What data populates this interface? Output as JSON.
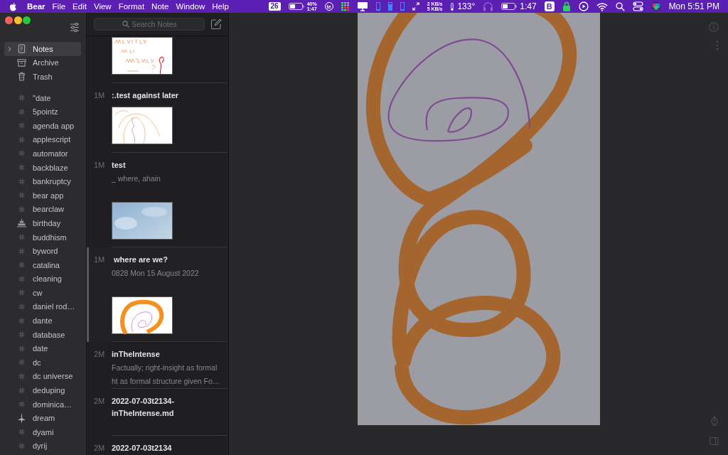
{
  "menu_bar": {
    "menus": [
      {
        "label": "Bear",
        "kind": "app"
      },
      {
        "label": "File",
        "kind": "menu"
      },
      {
        "label": "Edit",
        "kind": "menu"
      },
      {
        "label": "View",
        "kind": "menu"
      },
      {
        "label": "Format",
        "kind": "menu"
      },
      {
        "label": "Note",
        "kind": "menu"
      },
      {
        "label": "Window",
        "kind": "menu"
      },
      {
        "label": "Help",
        "kind": "menu"
      }
    ],
    "status_items": [
      {
        "kind": "badge",
        "text": "26"
      },
      {
        "kind": "battery",
        "lines": [
          "40%",
          "1:47"
        ]
      },
      {
        "kind": "logo",
        "text": "te"
      },
      {
        "kind": "bars"
      },
      {
        "kind": "display"
      },
      {
        "kind": "meter",
        "level": 0.15
      },
      {
        "kind": "meter",
        "level": 0.8
      },
      {
        "kind": "meter",
        "level": 0.1
      },
      {
        "kind": "arrows"
      },
      {
        "kind": "network",
        "lines": [
          "2 KB/s",
          "5 KB/s"
        ]
      },
      {
        "kind": "temperature",
        "text": "133°"
      },
      {
        "kind": "headphones",
        "dimmed": true
      },
      {
        "kind": "battery",
        "lines": [
          "1:47"
        ]
      },
      {
        "kind": "logo_square",
        "text": "B"
      },
      {
        "kind": "lock"
      },
      {
        "kind": "play"
      },
      {
        "kind": "wifi"
      },
      {
        "kind": "search"
      },
      {
        "kind": "toggles"
      },
      {
        "kind": "orb"
      }
    ],
    "clock": "Mon 5:51 PM"
  },
  "sidebar": {
    "sections": [
      {
        "label": "Notes",
        "kind": "notes",
        "selected": true,
        "expanded": false
      },
      {
        "label": "Archive",
        "kind": "archive",
        "selected": false
      },
      {
        "label": "Trash",
        "kind": "trash",
        "selected": false
      }
    ],
    "tags": [
      {
        "label": "\"date",
        "kind": "hash",
        "selected": false
      },
      {
        "label": "5pointz",
        "kind": "hash",
        "selected": false
      },
      {
        "label": "agenda app",
        "kind": "hash",
        "selected": false
      },
      {
        "label": "applescript",
        "kind": "hash",
        "selected": false
      },
      {
        "label": "automator",
        "kind": "hash",
        "selected": false
      },
      {
        "label": "backblaze",
        "kind": "hash",
        "selected": false
      },
      {
        "label": "bankruptcy",
        "kind": "hash",
        "selected": false
      },
      {
        "label": "bear app",
        "kind": "hash",
        "selected": false
      },
      {
        "label": "bearclaw",
        "kind": "hash",
        "selected": false
      },
      {
        "label": "birthday",
        "kind": "cake",
        "selected": false
      },
      {
        "label": "buddhism",
        "kind": "hash",
        "selected": false
      },
      {
        "label": "byword",
        "kind": "hash",
        "selected": false
      },
      {
        "label": "catalina",
        "kind": "hash",
        "selected": false
      },
      {
        "label": "cleaning",
        "kind": "hash",
        "selected": false
      },
      {
        "label": "cw",
        "kind": "hash",
        "selected": false
      },
      {
        "label": "daniel rod…",
        "kind": "hash",
        "selected": false
      },
      {
        "label": "dante",
        "kind": "hash",
        "selected": false
      },
      {
        "label": "database",
        "kind": "hash",
        "selected": false
      },
      {
        "label": "date",
        "kind": "hash",
        "selected": false
      },
      {
        "label": "dc",
        "kind": "hash",
        "selected": false
      },
      {
        "label": "dc universe",
        "kind": "hash",
        "selected": false
      },
      {
        "label": "deduping",
        "kind": "hash",
        "selected": false
      },
      {
        "label": "dominica…",
        "kind": "hash",
        "selected": false
      },
      {
        "label": "dream",
        "kind": "spire",
        "selected": false
      },
      {
        "label": "dyami",
        "kind": "hash",
        "selected": false
      },
      {
        "label": "dyrij",
        "kind": "hash",
        "selected": false
      }
    ]
  },
  "note_list": {
    "search": {
      "placeholder": "Search Notes"
    },
    "notes": [
      {
        "thumbnail": {
          "kind": "handwriting"
        },
        "selected": false
      },
      {
        "age": "1M",
        "title": ":.test against later",
        "thumbnail": {
          "kind": "scribble"
        },
        "selected": false
      },
      {
        "age": "1M",
        "title": "test",
        "preview": [
          "_ where, ahain"
        ],
        "thumbnail": {
          "kind": "photo"
        },
        "selected": false
      },
      {
        "age": "1M",
        "title": " where are we?",
        "preview": [
          "0828 Mon 15 August 2022"
        ],
        "thumbnail": {
          "kind": "loops"
        },
        "selected": true
      },
      {
        "age": "2M",
        "title": "inTheIntense",
        "preview": [
          "Factually; right-insight as formal",
          "ht as formal structure given Fo…"
        ],
        "selected": false
      },
      {
        "age": "2M",
        "title": "2022-07-03t2134-inTheIntense.md",
        "selected": false
      },
      {
        "age": "2M",
        "title": "2022-07-03t2134",
        "selected": false
      }
    ]
  },
  "editor": {
    "content": [
      {
        "kind": "sketch"
      }
    ]
  }
}
